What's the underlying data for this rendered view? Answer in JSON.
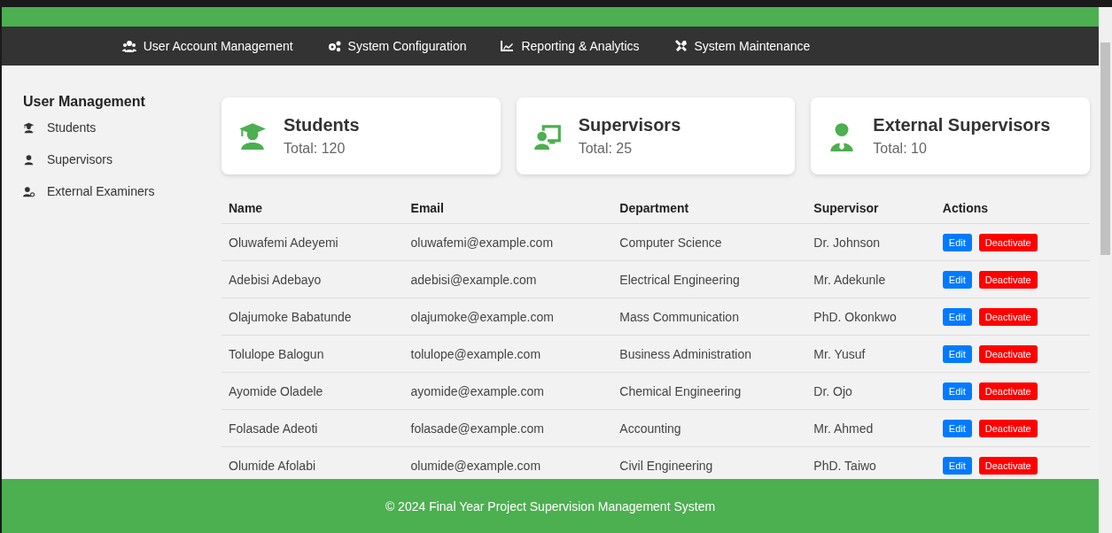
{
  "nav": [
    {
      "label": "User Account Management"
    },
    {
      "label": "System Configuration"
    },
    {
      "label": "Reporting & Analytics"
    },
    {
      "label": "System Maintenance"
    }
  ],
  "sidebar": {
    "title": "User Management",
    "items": [
      {
        "label": "Students"
      },
      {
        "label": "Supervisors"
      },
      {
        "label": "External Examiners"
      }
    ]
  },
  "cards": [
    {
      "title": "Students",
      "total": "Total: 120"
    },
    {
      "title": "Supervisors",
      "total": "Total: 25"
    },
    {
      "title": "External Supervisors",
      "total": "Total: 10"
    }
  ],
  "table": {
    "columns": [
      "Name",
      "Email",
      "Department",
      "Supervisor",
      "Actions"
    ],
    "rows": [
      {
        "cells": [
          "Oluwafemi Adeyemi",
          "oluwafemi@example.com",
          "Computer Science",
          "Dr. Johnson"
        ],
        "actions": [
          "Edit",
          "Deactivate"
        ]
      },
      {
        "cells": [
          "Adebisi Adebayo",
          "adebisi@example.com",
          "Electrical Engineering",
          "Mr. Adekunle"
        ],
        "actions": [
          "Edit",
          "Deactivate"
        ]
      },
      {
        "cells": [
          "Olajumoke Babatunde",
          "olajumoke@example.com",
          "Mass Communication",
          "PhD. Okonkwo"
        ],
        "actions": [
          "Edit",
          "Deactivate"
        ]
      },
      {
        "cells": [
          "Tolulope Balogun",
          "tolulope@example.com",
          "Business Administration",
          "Mr. Yusuf"
        ],
        "actions": [
          "Edit",
          "Deactivate"
        ]
      },
      {
        "cells": [
          "Ayomide Oladele",
          "ayomide@example.com",
          "Chemical Engineering",
          "Dr. Ojo"
        ],
        "actions": [
          "Edit",
          "Deactivate"
        ]
      },
      {
        "cells": [
          "Folasade Adeoti",
          "folasade@example.com",
          "Accounting",
          "Mr. Ahmed"
        ],
        "actions": [
          "Edit",
          "Deactivate"
        ]
      },
      {
        "cells": [
          "Olumide Afolabi",
          "olumide@example.com",
          "Civil Engineering",
          "PhD. Taiwo"
        ],
        "actions": [
          "Edit",
          "Deactivate"
        ]
      }
    ]
  },
  "footer": "© 2024 Final Year Project Supervision Management System"
}
